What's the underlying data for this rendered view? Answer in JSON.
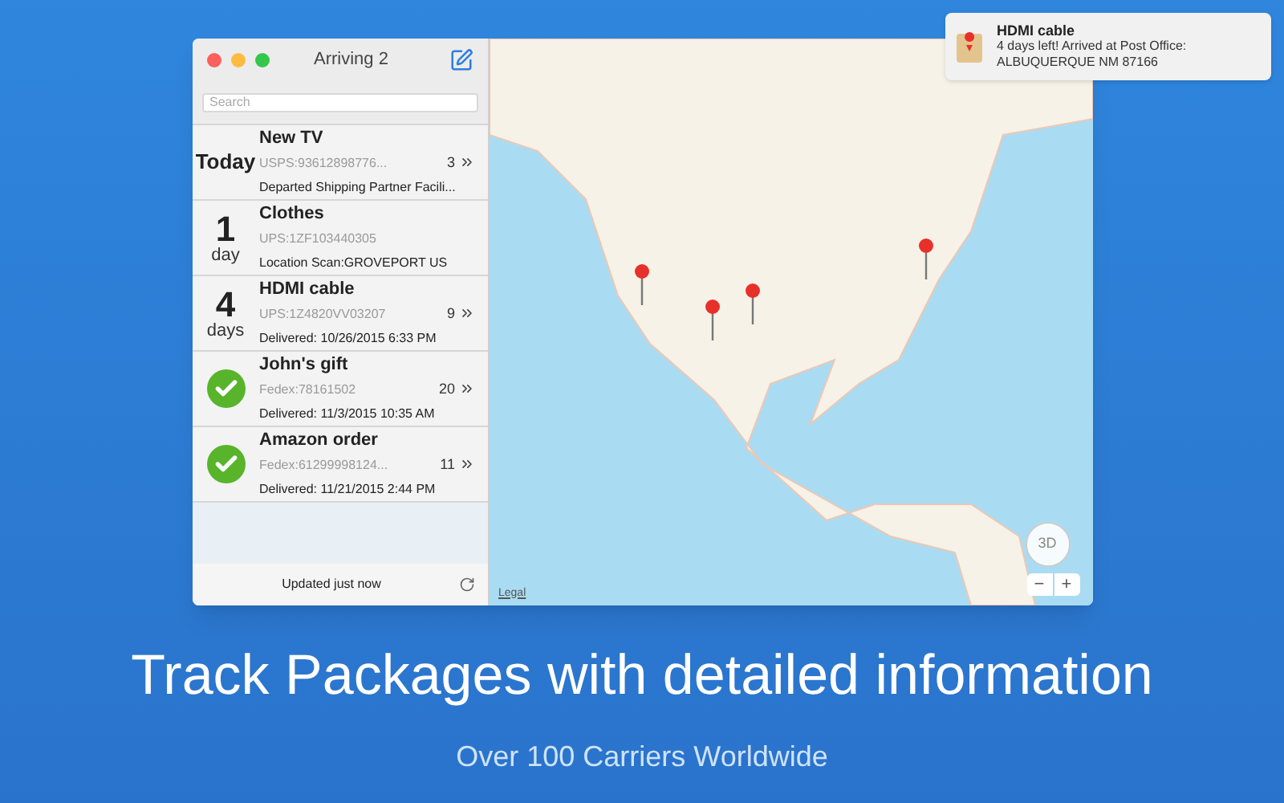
{
  "window": {
    "title": "Arriving 2"
  },
  "search": {
    "placeholder": "Search"
  },
  "packages": [
    {
      "name": "New TV",
      "left": {
        "kind": "label",
        "text": "Today"
      },
      "tracking": "USPS:93612898776...",
      "count": "3",
      "status": "Departed Shipping Partner Facili..."
    },
    {
      "name": "Clothes",
      "left": {
        "kind": "countdown",
        "number": "1",
        "unit": "day"
      },
      "tracking": "UPS:1ZF103440305",
      "status": "Location Scan:GROVEPORT US"
    },
    {
      "name": "HDMI cable",
      "left": {
        "kind": "countdown",
        "number": "4",
        "unit": "days"
      },
      "tracking": "UPS:1Z4820VV03207",
      "count": "9",
      "status": "Delivered: 10/26/2015 6:33 PM"
    },
    {
      "name": "John's gift",
      "left": {
        "kind": "delivered"
      },
      "tracking": "Fedex:78161502",
      "count": "20",
      "status": "Delivered: 11/3/2015 10:35 AM"
    },
    {
      "name": "Amazon order",
      "left": {
        "kind": "delivered"
      },
      "tracking": "Fedex:61299998124...",
      "count": "11",
      "status": "Delivered: 11/21/2015 2:44 PM"
    }
  ],
  "footer": {
    "text": "Updated just now"
  },
  "map": {
    "legal": "Legal",
    "compass": "3D",
    "zoom_out": "−",
    "zoom_in": "+"
  },
  "notification": {
    "title": "HDMI cable",
    "body": "4 days left! Arrived at Post Office: ALBUQUERQUE NM 87166"
  },
  "headline": "Track Packages with detailed information",
  "subheadline": "Over 100 Carriers Worldwide"
}
